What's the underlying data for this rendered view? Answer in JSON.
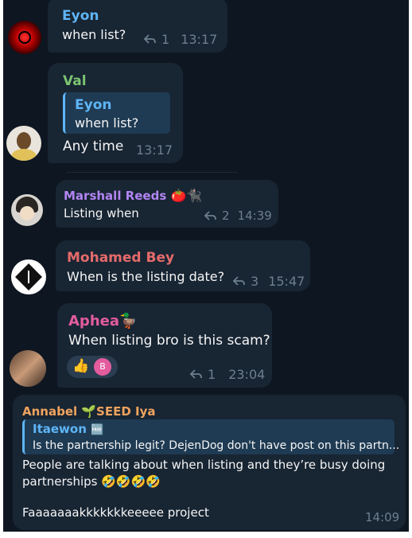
{
  "messages": [
    {
      "author": "Eyon",
      "text": "when list?",
      "replies": "1",
      "time": "13:17",
      "color": "#5eb5f7"
    },
    {
      "author": "Val",
      "quote_author": "Eyon",
      "quote_text": "when list?",
      "text": "Any time",
      "time": "13:17",
      "color": "#7cc470"
    },
    {
      "author": "Marshall Reeds",
      "author_emojis": "🍅🐈‍⬛",
      "text": "Listing when",
      "replies": "2",
      "time": "14:39",
      "color": "#b285f2"
    },
    {
      "author": "Mohamed Bey",
      "text": "When is the listing date?",
      "replies": "3",
      "time": "15:47",
      "color": "#e66b6b"
    },
    {
      "author": "Aphea",
      "author_emoji": "🦆",
      "text": "When listing bro is this scam?",
      "reaction_emoji": "👍",
      "reaction_avatar_letter": "B",
      "replies": "1",
      "time": "23:04",
      "color": "#e35c9e"
    },
    {
      "author": "Annabel 🌱SEED Iya",
      "quote_author": "Itaewon",
      "quote_badge": "🆓",
      "quote_text": "Is the partnership legit? DejenDog don't have post on this partn...",
      "text_line1": "People are talking about when listing and they’re busy doing",
      "text_line2": "partnerships 🤣🤣🤣🤣",
      "text_line3": "Faaaaaaakkkkkkkeeeee project",
      "time": "14:09",
      "color": "#f0a35e"
    }
  ],
  "colors": {
    "background": "#0e1621",
    "bubble": "#182533",
    "meta": "#6d7f8f",
    "quote_bar": "#5eb5f7"
  }
}
